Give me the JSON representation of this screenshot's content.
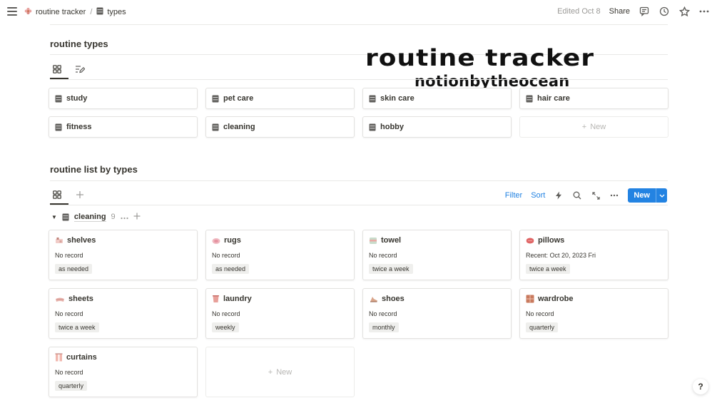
{
  "breadcrumb": {
    "root": "routine tracker",
    "separator": "/",
    "current": "types"
  },
  "topbar": {
    "edited": "Edited Oct 8",
    "share": "Share"
  },
  "banner": {
    "line1": "routine tracker",
    "line2": "notionbytheocean"
  },
  "sections": {
    "types_title": "routine types",
    "list_title": "routine list by types"
  },
  "types": [
    "study",
    "pet care",
    "skin care",
    "hair care",
    "fitness",
    "cleaning",
    "hobby"
  ],
  "new_label": "New",
  "toolbar": {
    "filter": "Filter",
    "sort": "Sort",
    "new": "New"
  },
  "group": {
    "name": "cleaning",
    "count": "9"
  },
  "routines": [
    {
      "name": "shelves",
      "record": "No record",
      "frequency": "as needed",
      "icon": "shelves-icon"
    },
    {
      "name": "rugs",
      "record": "No record",
      "frequency": "as needed",
      "icon": "rug-icon"
    },
    {
      "name": "towel",
      "record": "No record",
      "frequency": "twice a week",
      "icon": "towel-icon"
    },
    {
      "name": "pillows",
      "record": "Recent: Oct 20, 2023 Fri",
      "frequency": "twice a week",
      "icon": "pillow-icon"
    },
    {
      "name": "sheets",
      "record": "No record",
      "frequency": "twice a week",
      "icon": "sheets-icon"
    },
    {
      "name": "laundry",
      "record": "No record",
      "frequency": "weekly",
      "icon": "laundry-icon"
    },
    {
      "name": "shoes",
      "record": "No record",
      "frequency": "monthly",
      "icon": "shoe-icon"
    },
    {
      "name": "wardrobe",
      "record": "No record",
      "frequency": "quarterly",
      "icon": "wardrobe-icon"
    },
    {
      "name": "curtains",
      "record": "No record",
      "frequency": "quarterly",
      "icon": "curtain-icon"
    }
  ],
  "help_label": "?",
  "colors": {
    "accent": "#2383e2",
    "text": "#37352f",
    "muted": "#9b9a97",
    "tag_bg": "#efefed"
  }
}
